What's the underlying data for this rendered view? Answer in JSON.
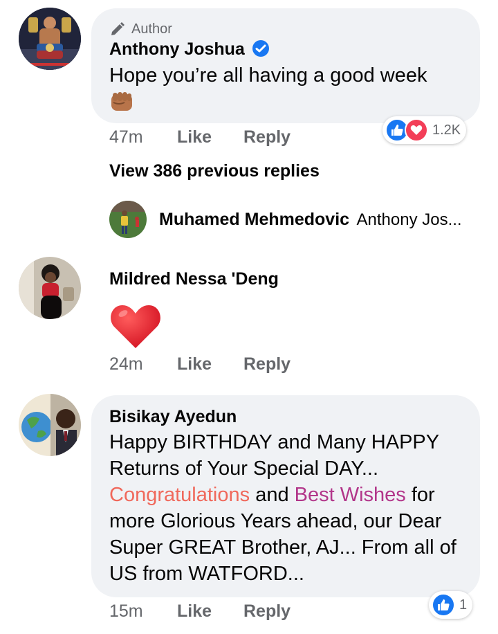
{
  "comments": [
    {
      "author_badge": "Author",
      "name": "Anthony Joshua",
      "verified": true,
      "text": "Hope you’re all having a good week",
      "emoji": "fist",
      "time": "47m",
      "like_label": "Like",
      "reply_label": "Reply",
      "reaction_count": "1.2K",
      "reaction_types": [
        "like",
        "love"
      ]
    }
  ],
  "view_previous_replies": "View 386 previous replies",
  "reply_preview": {
    "name": "Muhamed Mehmedovic",
    "snippet": "Anthony Jos..."
  },
  "comment2": {
    "name": "Mildred Nessa 'Deng",
    "emoji": "red-heart",
    "time": "24m",
    "like_label": "Like",
    "reply_label": "Reply"
  },
  "comment3": {
    "name": "Bisikay Ayedun",
    "text_part1": "Happy BIRTHDAY and Many HAPPY Returns of Your Special DAY...",
    "highlight1": "Congratulations",
    "text_and": " and ",
    "highlight2": "Best Wishes",
    "text_part2": " for more Glorious Years ahead, our Dear Super GREAT Brother, AJ... From all of US from WATFORD...",
    "time": "15m",
    "like_label": "Like",
    "reply_label": "Reply",
    "reaction_count": "1",
    "reaction_types": [
      "like"
    ]
  },
  "colors": {
    "fb_blue": "#1877f2",
    "love_red": "#f33e58",
    "highlight1": "#f0685b",
    "highlight2": "#b2368a",
    "meta_gray": "#65676b",
    "bubble_bg": "#f0f2f5"
  }
}
